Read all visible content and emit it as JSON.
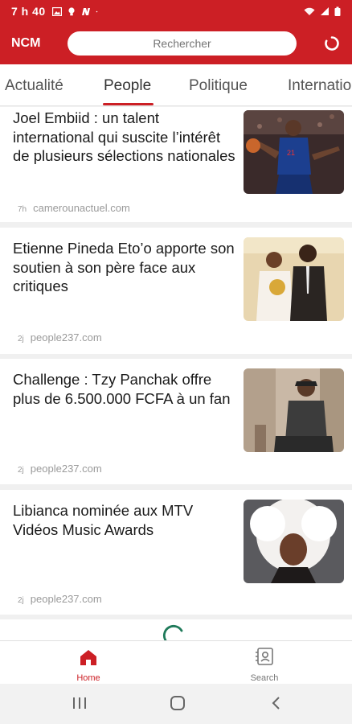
{
  "status_bar": {
    "time": "7 h 40",
    "notification_icons": [
      "image-icon",
      "bulb-icon",
      "n-app-icon",
      "dot-icon"
    ],
    "system_icons": [
      "wifi-icon",
      "signal-icon",
      "battery-icon"
    ]
  },
  "app_bar": {
    "brand": "NCM",
    "search_placeholder": "Rechercher",
    "refresh_icon": "refresh-icon"
  },
  "tabs": [
    {
      "label": "Actualité",
      "active": false
    },
    {
      "label": "People",
      "active": true
    },
    {
      "label": "Politique",
      "active": false
    },
    {
      "label": "Internatio",
      "active": false
    }
  ],
  "articles": [
    {
      "title": "Joel Embiid : un talent international qui suscite l’intérêt de plusieurs sélections nationales",
      "age": "7h",
      "source": "camerounactuel.com",
      "thumb": "basketball-player-image"
    },
    {
      "title": "Etienne Pineda Eto’o apporte son soutien à son père face aux critiques",
      "age": "2j",
      "source": "people237.com",
      "thumb": "two-men-trophy-image"
    },
    {
      "title": "Challenge : Tzy Panchak offre plus de 6.500.000 FCFA à un fan",
      "age": "2j",
      "source": "people237.com",
      "thumb": "man-seated-cap-image"
    },
    {
      "title": "Libianca nominée aux MTV Vidéos Music Awards",
      "age": "2j",
      "source": "people237.com",
      "thumb": "woman-white-afro-image"
    }
  ],
  "bottom_nav": [
    {
      "label": "Home",
      "icon": "home-icon",
      "active": true
    },
    {
      "label": "Search",
      "icon": "search-list-icon",
      "active": false
    }
  ],
  "colors": {
    "brand_red": "#cc1f25",
    "loading_green": "#1f7a5a",
    "text_dark": "#1a1a1a",
    "meta_gray": "#9a9a9a"
  }
}
